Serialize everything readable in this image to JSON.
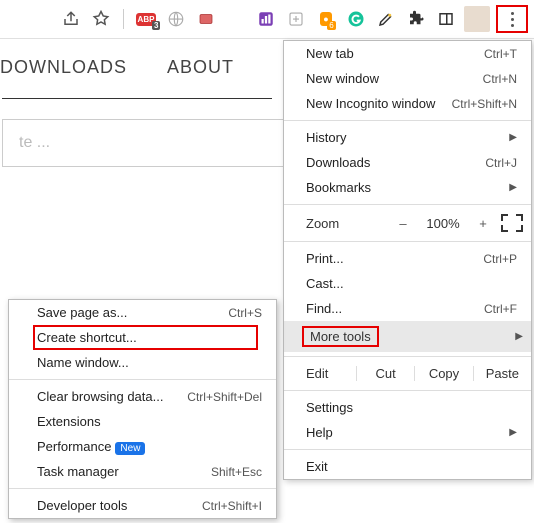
{
  "toolbar_badges": {
    "abp": "3",
    "orange": "6"
  },
  "nav": {
    "downloads": "DOWNLOADS",
    "about": "ABOUT"
  },
  "input_placeholder": "te ...",
  "menu": {
    "new_tab": "New tab",
    "new_tab_sc": "Ctrl+T",
    "new_window": "New window",
    "new_window_sc": "Ctrl+N",
    "incognito": "New Incognito window",
    "incognito_sc": "Ctrl+Shift+N",
    "history": "History",
    "downloads": "Downloads",
    "downloads_sc": "Ctrl+J",
    "bookmarks": "Bookmarks",
    "zoom": "Zoom",
    "zoom_pct": "100%",
    "minus": "–",
    "plus": "+",
    "print": "Print...",
    "print_sc": "Ctrl+P",
    "cast": "Cast...",
    "find": "Find...",
    "find_sc": "Ctrl+F",
    "more_tools": "More tools",
    "edit": "Edit",
    "cut": "Cut",
    "copy": "Copy",
    "paste": "Paste",
    "settings": "Settings",
    "help": "Help",
    "exit": "Exit"
  },
  "sub": {
    "save_page": "Save page as...",
    "save_page_sc": "Ctrl+S",
    "create_shortcut": "Create shortcut...",
    "name_window": "Name window...",
    "clear_data": "Clear browsing data...",
    "clear_data_sc": "Ctrl+Shift+Del",
    "extensions": "Extensions",
    "performance": "Performance",
    "new": "New",
    "task_mgr": "Task manager",
    "task_mgr_sc": "Shift+Esc",
    "dev_tools": "Developer tools",
    "dev_tools_sc": "Ctrl+Shift+I"
  }
}
